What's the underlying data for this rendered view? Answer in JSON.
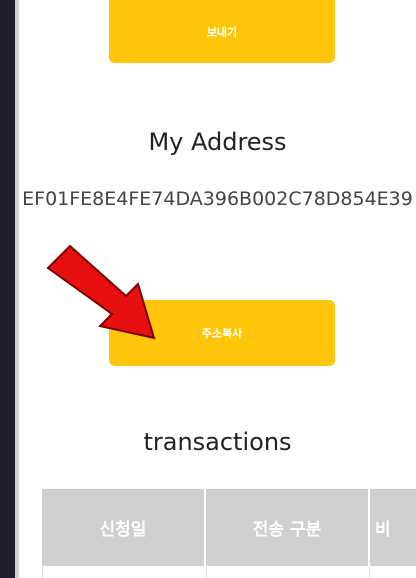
{
  "send_button": {
    "label": "보내기"
  },
  "address_section": {
    "title": "My Address",
    "address": "EF01FE8E4FE74DA396B002C78D854E39",
    "copy_button": {
      "label": "주소복사"
    }
  },
  "transactions": {
    "title": "transactions",
    "columns": [
      "신청일",
      "전송 구분",
      "비"
    ]
  },
  "colors": {
    "button": "#ffc50a",
    "header": "#cfcfcf",
    "arrow": "#e61010"
  }
}
